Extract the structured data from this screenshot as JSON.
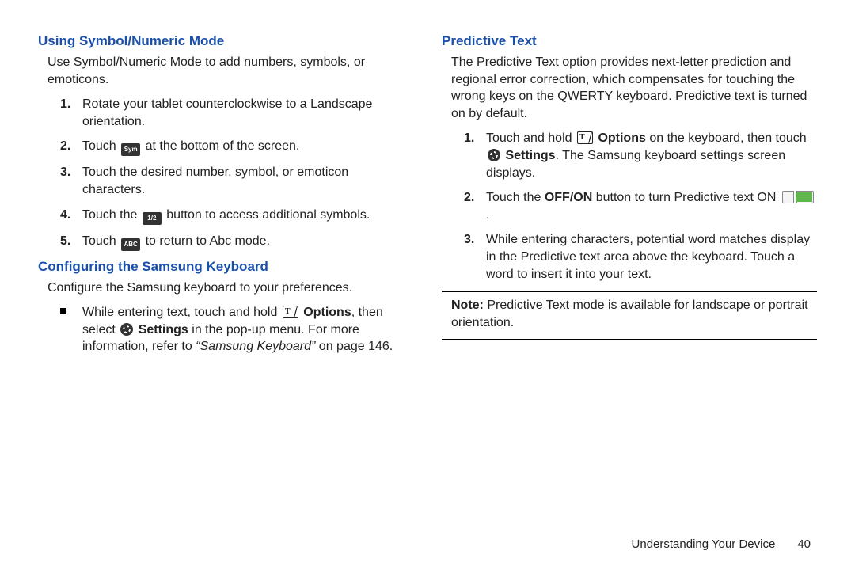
{
  "left": {
    "section1_title": "Using Symbol/Numeric Mode",
    "section1_intro": "Use Symbol/Numeric Mode to add numbers, symbols, or emoticons.",
    "s1_step1": "Rotate your tablet counterclockwise to a Landscape orientation.",
    "s1_step2_a": "Touch ",
    "s1_step2_b": " at the bottom of the screen.",
    "s1_step3": "Touch the desired number, symbol, or emoticon characters.",
    "s1_step4_a": "Touch the ",
    "s1_step4_b": " button to access additional symbols.",
    "s1_step5_a": "Touch ",
    "s1_step5_b": " to return to Abc mode.",
    "key_sym": "Sym",
    "key_half": "1/2",
    "key_abc": "ABC",
    "section2_title": "Configuring the Samsung Keyboard",
    "section2_intro": "Configure the Samsung keyboard to your preferences.",
    "s2_b1_a": "While entering text, touch and hold ",
    "s2_b1_opt": "Options",
    "s2_b1_b": ", then select ",
    "s2_b1_set": "Settings",
    "s2_b1_c": " in the pop-up menu. ",
    "s2_b1_d": "For more information, refer to ",
    "s2_b1_ref": "“Samsung Keyboard”",
    "s2_b1_e": " on page 146."
  },
  "right": {
    "section3_title": "Predictive Text",
    "section3_intro": "The Predictive Text option provides next-letter prediction and regional error correction, which compensates for touching the wrong keys on the QWERTY keyboard. Predictive text is turned on by default.",
    "s3_step1_a": "Touch and hold ",
    "s3_step1_opt": "Options",
    "s3_step1_b": " on the keyboard, then touch ",
    "s3_step1_set": "Settings",
    "s3_step1_c": ". The Samsung keyboard settings screen displays.",
    "s3_step2_a": "Touch the ",
    "s3_step2_btn": "OFF/ON",
    "s3_step2_b": " button to turn Predictive text ON ",
    "s3_step2_c": ".",
    "s3_step3": "While entering characters, potential word matches display in the Predictive text area above the keyboard. Touch a word to insert it into your text.",
    "note_label": "Note:",
    "note_body": " Predictive Text mode is available for landscape or portrait orientation."
  },
  "footer": {
    "chapter": "Understanding Your Device",
    "page": "40"
  }
}
